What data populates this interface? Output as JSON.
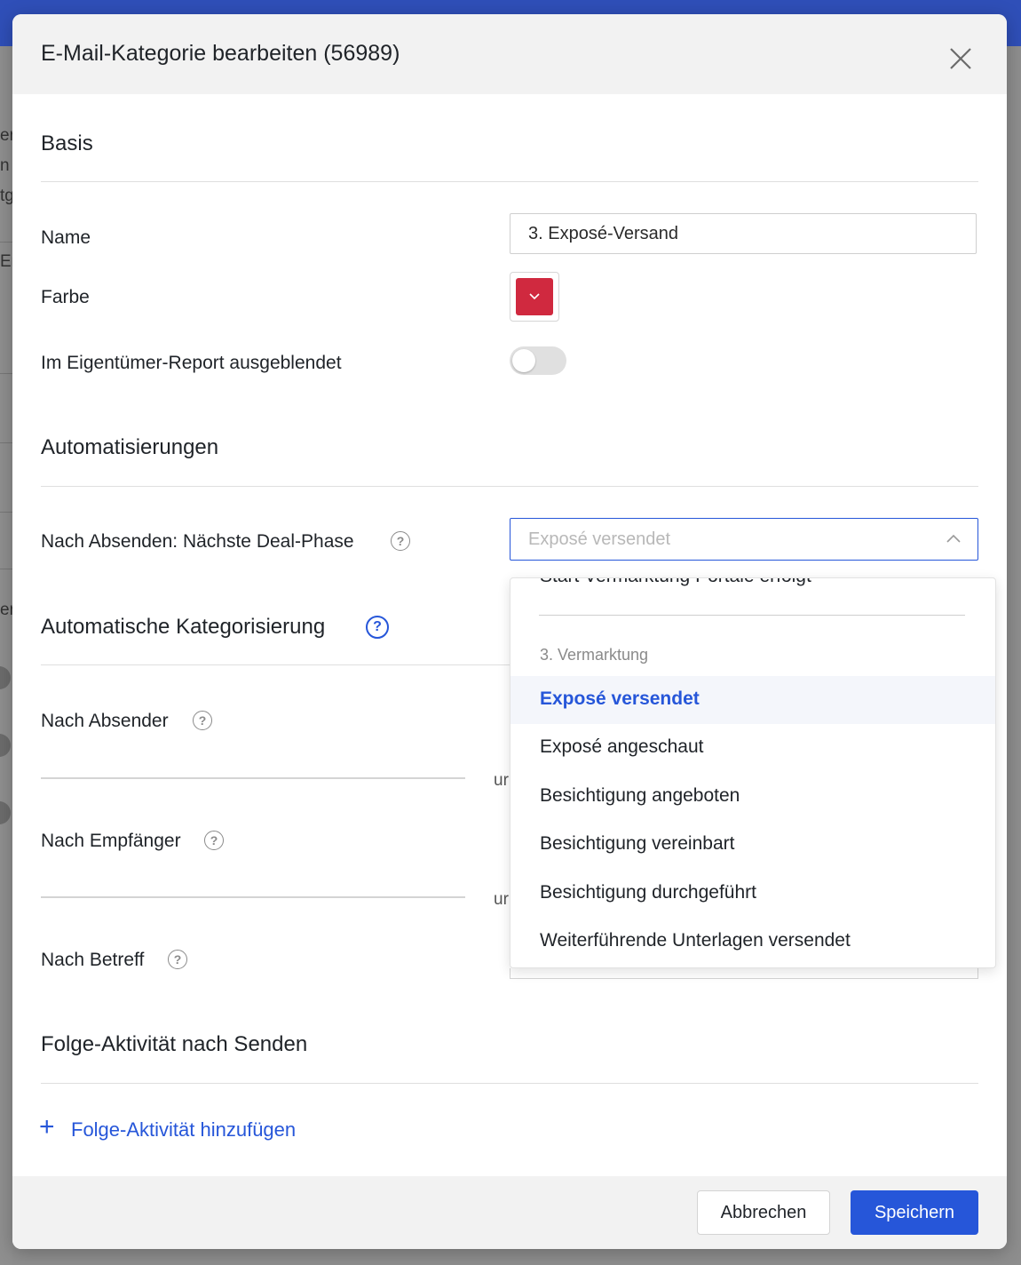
{
  "background": {
    "fragments": [
      "er",
      "n",
      "tg",
      "Em",
      "er"
    ]
  },
  "modal": {
    "title": "E-Mail-Kategorie bearbeiten (56989)"
  },
  "basis": {
    "title": "Basis",
    "name_label": "Name",
    "name_value": "3. Exposé-Versand",
    "color_label": "Farbe",
    "color_value": "#d0293f",
    "hidden_label": "Im Eigentümer-Report ausgeblendet",
    "hidden_on": false
  },
  "automations": {
    "title": "Automatisierungen",
    "next_phase_label": "Nach Absenden: Nächste Deal-Phase",
    "next_phase_placeholder": "Exposé versendet"
  },
  "auto_cat": {
    "title": "Automatische Kategorisierung",
    "sender_label": "Nach Absender",
    "recipient_label": "Nach Empfänger",
    "subject_label": "Nach Betreff",
    "und_fragment": "ur"
  },
  "followup": {
    "title": "Folge-Aktivität nach Senden",
    "add_label": "Folge-Aktivität hinzufügen"
  },
  "dropdown": {
    "cut_item": "Start Vermarktung Portale erfolgt",
    "group_label": "3. Vermarktung",
    "items": [
      "Exposé versendet",
      "Exposé angeschaut",
      "Besichtigung angeboten",
      "Besichtigung vereinbart",
      "Besichtigung durchgeführt",
      "Weiterführende Unterlagen versendet"
    ]
  },
  "footer": {
    "cancel_label": "Abbrechen",
    "save_label": "Speichern"
  },
  "colors": {
    "accent": "#2656d9",
    "topbar": "#2f4fb8"
  },
  "icons": {
    "close": "close-icon",
    "help": "help-icon",
    "chevron": "chevron-up-icon",
    "color_chevron": "chevron-down-icon",
    "add": "plus-icon"
  }
}
